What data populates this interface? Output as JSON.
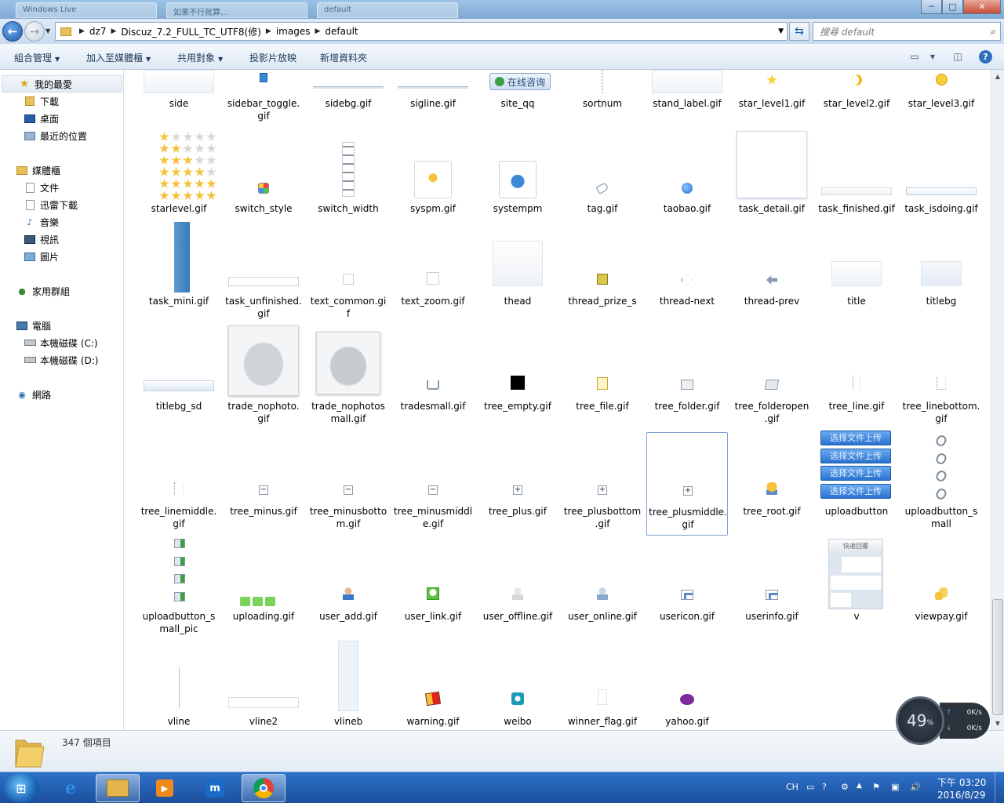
{
  "window": {
    "tabs": [
      "Windows Live",
      "如果不行就算...",
      "default"
    ],
    "controls": {
      "minimize": "─",
      "maximize": "□",
      "close": "✕"
    }
  },
  "address": {
    "crumbs": [
      "dz7",
      "Discuz_7.2_FULL_TC_UTF8(修)",
      "images",
      "default"
    ],
    "search_placeholder": "搜尋 default"
  },
  "toolbar": {
    "commands": [
      "組合管理",
      "加入至媒體櫃",
      "共用對象",
      "投影片放映",
      "新增資料夾"
    ]
  },
  "navpane": {
    "favorites": "我的最愛",
    "favorites_items": [
      "下載",
      "桌面",
      "最近的位置"
    ],
    "libraries": "媒體櫃",
    "libraries_items": [
      "文件",
      "迅雷下載",
      "音樂",
      "視訊",
      "圖片"
    ],
    "homegroup": "家用群組",
    "computer": "電腦",
    "computer_items": [
      "本機磁碟 (C:)",
      "本機磁碟 (D:)"
    ],
    "network": "網路"
  },
  "files": [
    {
      "name": "side",
      "thumb": "bar-light"
    },
    {
      "name": "sidebar_toggle.\ngif",
      "thumb": "small-blue"
    },
    {
      "name": "sidebg.gif",
      "thumb": "hline"
    },
    {
      "name": "sigline.gif",
      "thumb": "hline"
    },
    {
      "name": "site_qq",
      "thumb": "qq-button",
      "text": "在线咨询"
    },
    {
      "name": "sortnum",
      "thumb": "vdots"
    },
    {
      "name": "stand_label.gif",
      "thumb": "bar-light"
    },
    {
      "name": "star_level1.gif",
      "thumb": "star"
    },
    {
      "name": "star_level2.gif",
      "thumb": "moon"
    },
    {
      "name": "star_level3.gif",
      "thumb": "sun"
    },
    {
      "name": "starlevel.gif",
      "thumb": "stars-grid"
    },
    {
      "name": "switch_style",
      "thumb": "palette"
    },
    {
      "name": "switch_width",
      "thumb": "arrows-col"
    },
    {
      "name": "syspm.gif",
      "thumb": "bulb"
    },
    {
      "name": "systempm",
      "thumb": "sys-box"
    },
    {
      "name": "tag.gif",
      "thumb": "tag"
    },
    {
      "name": "taobao.gif",
      "thumb": "taobao"
    },
    {
      "name": "task_detail.gif",
      "thumb": "big-white"
    },
    {
      "name": "task_finished.gif",
      "thumb": "thin-box"
    },
    {
      "name": "task_isdoing.gif",
      "thumb": "thin-box-blue"
    },
    {
      "name": "task_mini.gif",
      "thumb": "vbar-blue"
    },
    {
      "name": "task_unfinished.\ngif",
      "thumb": "thin-box-low"
    },
    {
      "name": "text_common.gi\nf",
      "thumb": "text-t"
    },
    {
      "name": "text_zoom.gif",
      "thumb": "text-t-blue"
    },
    {
      "name": "thead",
      "thumb": "thead-box"
    },
    {
      "name": "thread_prize_s",
      "thumb": "prize"
    },
    {
      "name": "thread-next",
      "thumb": "next-arrow"
    },
    {
      "name": "thread-prev",
      "thumb": "prev-arrow"
    },
    {
      "name": "title",
      "thumb": "title-box"
    },
    {
      "name": "titlebg",
      "thumb": "title-box-blue"
    },
    {
      "name": "titlebg_sd",
      "thumb": "hbar-grad"
    },
    {
      "name": "trade_nophoto.\ngif",
      "thumb": "nophoto"
    },
    {
      "name": "trade_nophotos\nmall.gif",
      "thumb": "nophoto-small"
    },
    {
      "name": "tradesmall.gif",
      "thumb": "cart"
    },
    {
      "name": "tree_empty.gif",
      "thumb": "black-square"
    },
    {
      "name": "tree_file.gif",
      "thumb": "file"
    },
    {
      "name": "tree_folder.gif",
      "thumb": "folder"
    },
    {
      "name": "tree_folderopen\n.gif",
      "thumb": "folder-open"
    },
    {
      "name": "tree_line.gif",
      "thumb": "tree-line"
    },
    {
      "name": "tree_linebottom.\ngif",
      "thumb": "tree-corner"
    },
    {
      "name": "tree_linemiddle.\ngif",
      "thumb": "tree-middle"
    },
    {
      "name": "tree_minus.gif",
      "thumb": "minus-box"
    },
    {
      "name": "tree_minusbotto\nm.gif",
      "thumb": "minus-box"
    },
    {
      "name": "tree_minusmiddl\ne.gif",
      "thumb": "minus-box"
    },
    {
      "name": "tree_plus.gif",
      "thumb": "plus-box"
    },
    {
      "name": "tree_plusbottom\n.gif",
      "thumb": "plus-box"
    },
    {
      "name": "tree_plusmiddle.\ngif",
      "thumb": "plus-box",
      "selected": true
    },
    {
      "name": "tree_root.gif",
      "thumb": "root"
    },
    {
      "name": "uploadbutton",
      "thumb": "upload-buttons",
      "text": "选择文件上传"
    },
    {
      "name": "uploadbutton_s\nmall",
      "thumb": "clips"
    },
    {
      "name": "uploadbutton_s\nmall_pic",
      "thumb": "green-arrows"
    },
    {
      "name": "uploading.gif",
      "thumb": "green-dots"
    },
    {
      "name": "user_add.gif",
      "thumb": "user-add"
    },
    {
      "name": "user_link.gif",
      "thumb": "user-link"
    },
    {
      "name": "user_offline.gif",
      "thumb": "user-offline"
    },
    {
      "name": "user_online.gif",
      "thumb": "user-online"
    },
    {
      "name": "usericon.gif",
      "thumb": "card"
    },
    {
      "name": "userinfo.gif",
      "thumb": "card"
    },
    {
      "name": "v",
      "thumb": "v-panel",
      "text": "快速回覆"
    },
    {
      "name": "viewpay.gif",
      "thumb": "coins"
    },
    {
      "name": "vline",
      "thumb": "vline"
    },
    {
      "name": "vline2",
      "thumb": "hbar-thin"
    },
    {
      "name": "vlineb",
      "thumb": "tall-pale"
    },
    {
      "name": "warning.gif",
      "thumb": "warning"
    },
    {
      "name": "weibo",
      "thumb": "weibo"
    },
    {
      "name": "winner_flag.gif",
      "thumb": "flag-blank"
    },
    {
      "name": "yahoo.gif",
      "thumb": "yahoo"
    }
  ],
  "details": {
    "count": "347 個項目"
  },
  "speed": {
    "percent": "49",
    "unit": "%",
    "up": "0K/s",
    "down": "0K/s"
  },
  "taskbar": {
    "apps": [
      "internet-explorer",
      "file-explorer",
      "media-player",
      "maxthon",
      "chrome"
    ],
    "tray_lang": "CH",
    "time": "下午 03:20",
    "date": "2016/8/29"
  }
}
